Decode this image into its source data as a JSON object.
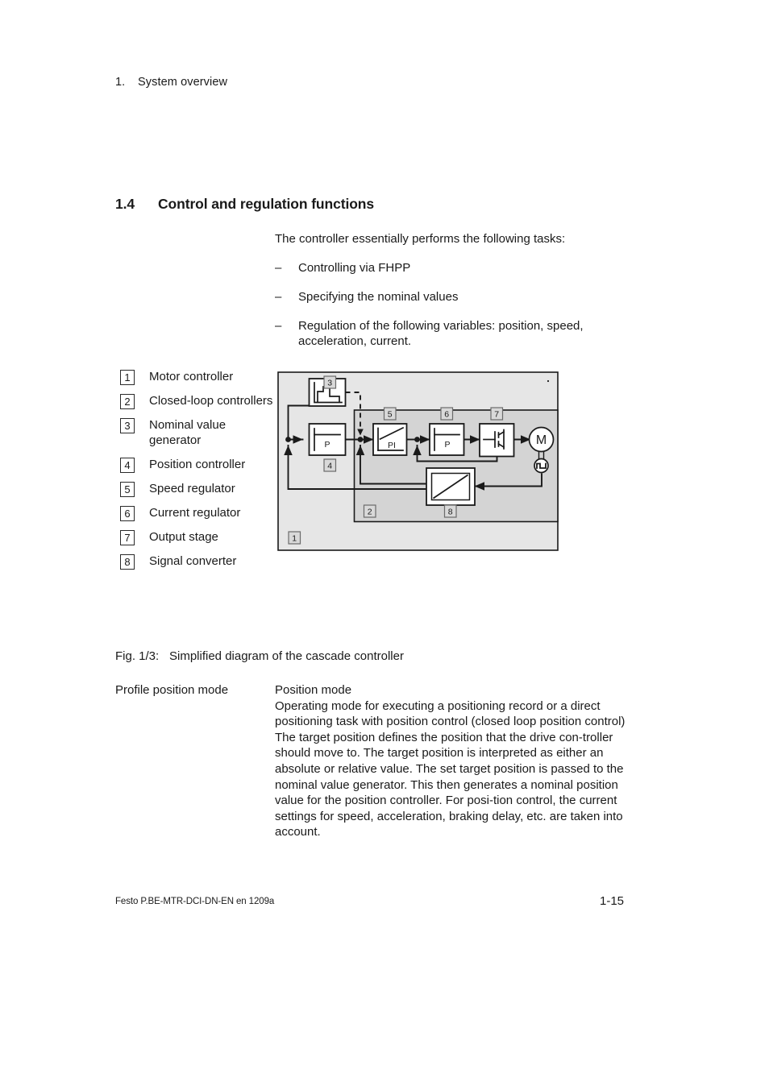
{
  "running_header": {
    "number": "1.",
    "title": "System overview"
  },
  "section": {
    "number": "1.4",
    "title": "Control and regulation functions"
  },
  "intro": {
    "lead": "The controller essentially performs the following tasks:",
    "dash": "–",
    "bullets": [
      "Controlling via FHPP",
      "Specifying the nominal values",
      "Regulation of the following variables: position, speed, acceleration, current."
    ]
  },
  "legend": {
    "items": [
      {
        "num": "1",
        "label": "Motor controller"
      },
      {
        "num": "2",
        "label": "Closed-loop controllers"
      },
      {
        "num": "3",
        "label": "Nominal value generator"
      },
      {
        "num": "4",
        "label": "Position controller"
      },
      {
        "num": "5",
        "label": "Speed regulator"
      },
      {
        "num": "6",
        "label": "Current regulator"
      },
      {
        "num": "7",
        "label": "Output stage"
      },
      {
        "num": "8",
        "label": "Signal converter"
      }
    ]
  },
  "figure": {
    "callouts": {
      "motor_controller": "1",
      "closed_loop_controllers": "2",
      "nominal_value_generator": "3",
      "position_controller": "4",
      "speed_regulator": "5",
      "current_regulator": "6",
      "output_stage": "7",
      "signal_converter": "8"
    },
    "block_labels": {
      "position_controller": "P",
      "speed_regulator": "PI",
      "current_regulator": "P",
      "motor": "M"
    },
    "colors": {
      "outer_fill": "#e6e6e6",
      "inner_fill": "#d4d4d4",
      "block_fill": "#ffffff",
      "stroke": "#1a1a1a",
      "callout_fill": "#d9d9d9"
    }
  },
  "fig_caption": {
    "label": "Fig. 1/3:",
    "text": "Simplified diagram of the cascade controller"
  },
  "definition": {
    "term": "Profile position mode",
    "heading": "Position mode",
    "paragraph1": "Operating mode for executing a positioning record or a direct positioning task with position control (closed loop position control)",
    "paragraph2": "The target position defines the position that the drive con‑troller should move to. The target position is interpreted as either an absolute or relative value. The set target position is passed to the nominal value generator. This then generates a nominal position value for the position controller. For posi‑tion control, the current settings for speed, acceleration, braking delay, etc. are taken into account."
  },
  "footer": {
    "document_id": "Festo P.BE‑MTR‑DCI‑DN‑EN  en 1209a",
    "page_number": "1‑15"
  }
}
